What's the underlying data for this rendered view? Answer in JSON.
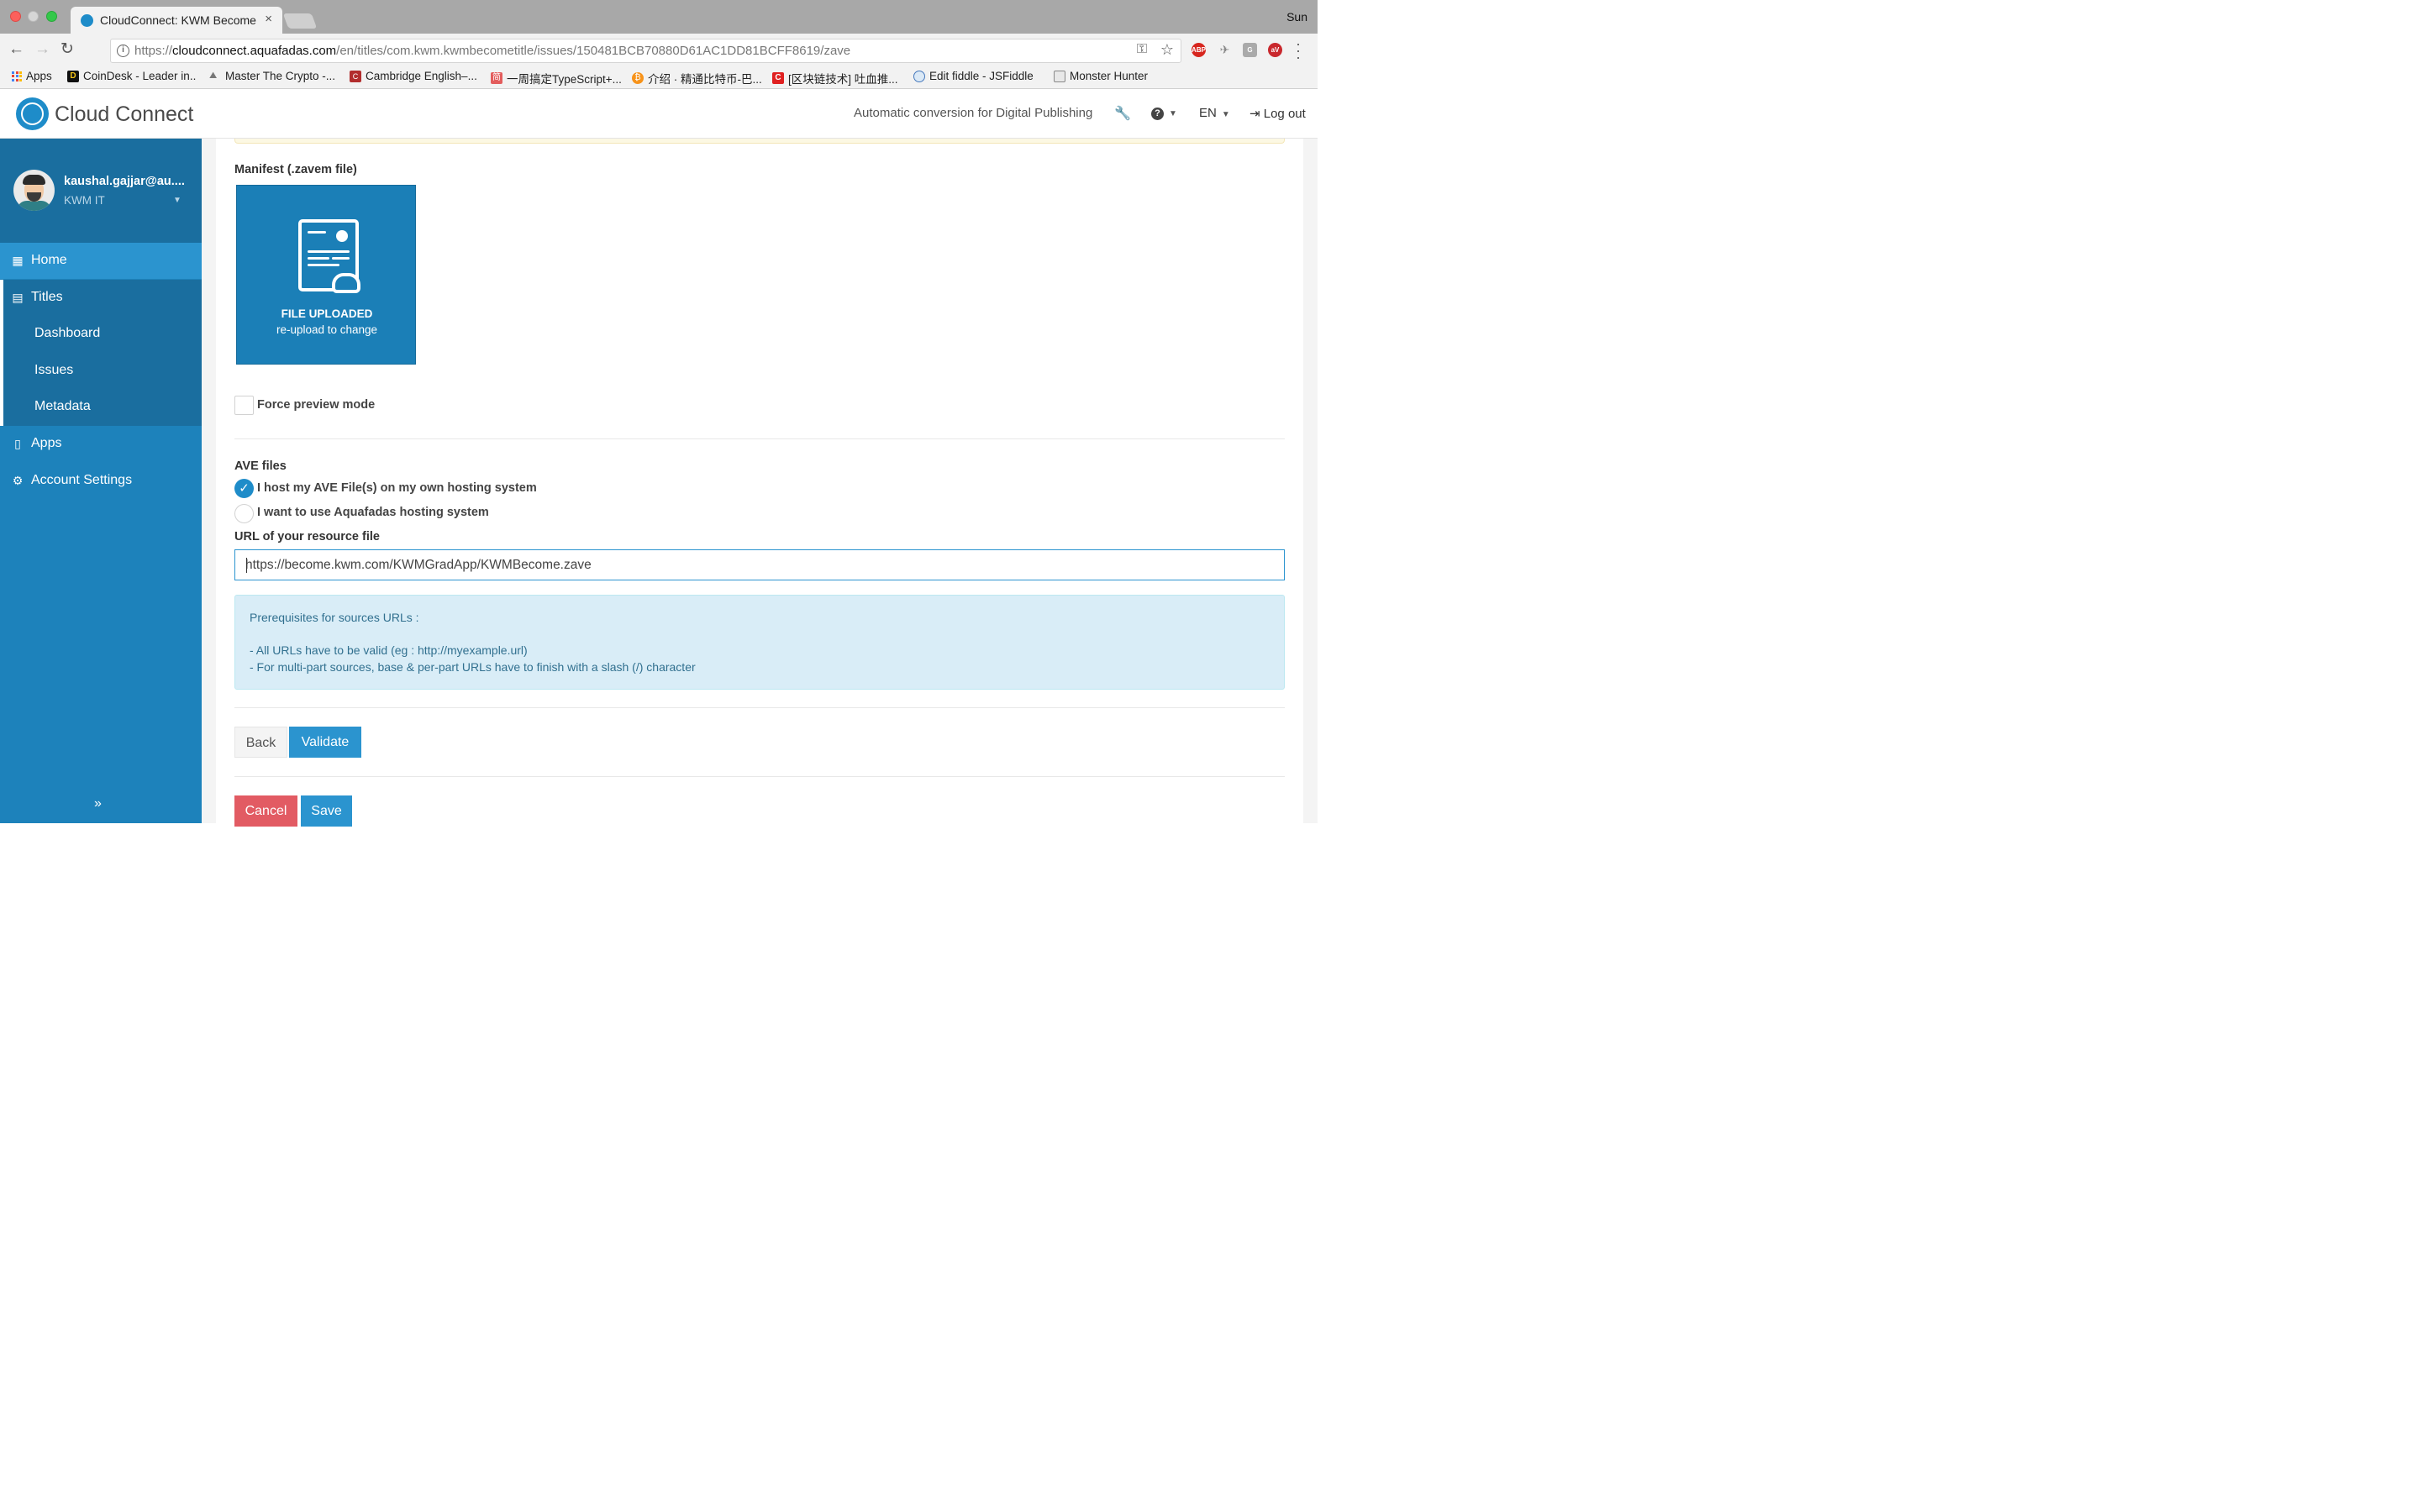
{
  "browser": {
    "tab_title": "CloudConnect: KWM Become",
    "tab_close": "×",
    "os_user": "Sun",
    "url_prefix": "https://",
    "url_host": "cloudconnect.aquafadas.com",
    "url_path": "/en/titles/com.kwm.kwmbecometitle/issues/150481BCB70880D61AC1DD81BCFF8619/zave",
    "ext_abp": "ABP",
    "ext_g": "G",
    "ext_av": "aV",
    "bookmarks": [
      "Apps",
      "CoinDesk - Leader in..",
      "Master The Crypto -...",
      "Cambridge English–...",
      "一周搞定TypeScript+...",
      "介绍 · 精通比特币-巴...",
      "[区块链技术] 吐血推...",
      "Edit fiddle - JSFiddle",
      "Monster Hunter"
    ],
    "bookmark_icon_glyphs": {
      "coindesk": "D",
      "cambridge": "C",
      "typescript": "简",
      "bitcoin": "₿",
      "blockchain": "C"
    }
  },
  "header": {
    "brand": "Cloud Connect",
    "tagline": "Automatic conversion for Digital Publishing",
    "language": "EN",
    "logout": "Log out"
  },
  "sidebar": {
    "user_email": "kaushal.gajjar@au....",
    "user_org": "KWM IT",
    "items": {
      "home": "Home",
      "titles": "Titles",
      "dashboard": "Dashboard",
      "issues": "Issues",
      "metadata": "Metadata",
      "apps": "Apps",
      "account": "Account Settings"
    },
    "collapse": "»"
  },
  "form": {
    "manifest_label": "Manifest (.zavem file)",
    "upload_title": "FILE UPLOADED",
    "upload_sub": "re-upload to change",
    "force_preview": "Force preview mode",
    "force_preview_checked": false,
    "ave_files_label": "AVE files",
    "option_own_hosting": "I host my AVE File(s) on my own hosting system",
    "option_aquafadas": "I want to use Aquafadas hosting system",
    "selected_option": "own_hosting",
    "url_label": "URL of your resource file",
    "url_value": "https://become.kwm.com/KWMGradApp/KWMBecome.zave",
    "info_title": "Prerequisites for sources URLs :",
    "info_line1": "- All URLs have to be valid (eg : http://myexample.url)",
    "info_line2": "- For multi-part sources, base & per-part URLs have to finish with a slash (/) character",
    "back": "Back",
    "validate": "Validate",
    "cancel": "Cancel",
    "save": "Save"
  },
  "colors": {
    "brand_blue": "#1e8cc9",
    "sidebar": "#1d82bb",
    "sidebar_dark": "#1a6e9f",
    "cancel_red": "#e25b63"
  }
}
